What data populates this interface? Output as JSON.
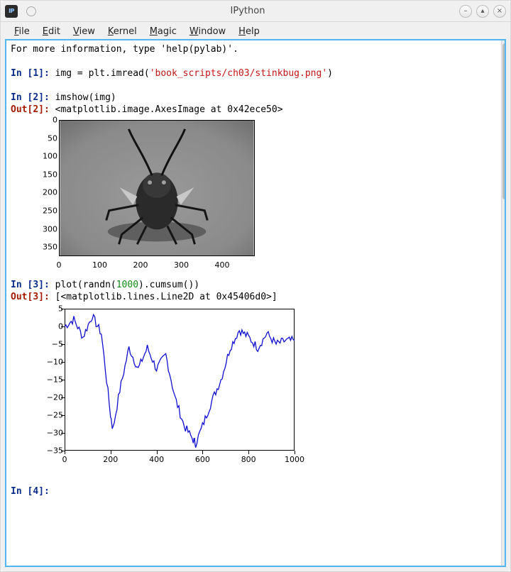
{
  "window": {
    "title": "IPython",
    "app_icon_text": "IP[y]"
  },
  "menubar": [
    {
      "key": "F",
      "rest": "ile"
    },
    {
      "key": "E",
      "rest": "dit"
    },
    {
      "key": "V",
      "rest": "iew"
    },
    {
      "key": "K",
      "rest": "ernel"
    },
    {
      "key": "M",
      "rest": "agic"
    },
    {
      "key": "W",
      "rest": "indow"
    },
    {
      "key": "H",
      "rest": "elp"
    }
  ],
  "preamble": "For more information, type 'help(pylab)'.",
  "cells": {
    "c1": {
      "in_label": "In [",
      "n": "1",
      "in_close": "]: ",
      "code_pre": "img = plt.imread(",
      "code_str": "'book_scripts/ch03/stinkbug.png'",
      "code_post": ")"
    },
    "c2": {
      "in_label": "In [",
      "n": "2",
      "in_close": "]: ",
      "code": "imshow(img)",
      "out_label": "Out[",
      "out_close": "]: ",
      "out_val": "<matplotlib.image.AxesImage at 0x42ece50>"
    },
    "c3": {
      "in_label": "In [",
      "n": "3",
      "in_close": "]: ",
      "code_pre": "plot(randn(",
      "code_num": "1000",
      "code_post": ").cumsum())",
      "out_label": "Out[",
      "out_close": "]: ",
      "out_val": "[<matplotlib.lines.Line2D at 0x45406d0>]"
    },
    "c4": {
      "in_label": "In [",
      "n": "4",
      "in_close": "]: "
    }
  },
  "chart_data": [
    {
      "type": "heatmap",
      "title": "",
      "description": "grayscale image displayed with imshow (stinkbug.png)",
      "xlabel": "",
      "ylabel": "",
      "xlim": [
        0,
        480
      ],
      "ylim": [
        375,
        0
      ],
      "x_ticks": [
        0,
        100,
        200,
        300,
        400
      ],
      "y_ticks": [
        0,
        50,
        100,
        150,
        200,
        250,
        300,
        350
      ]
    },
    {
      "type": "line",
      "title": "",
      "xlabel": "",
      "ylabel": "",
      "xlim": [
        0,
        1000
      ],
      "ylim": [
        -35,
        5
      ],
      "x_ticks": [
        0,
        200,
        400,
        600,
        800,
        1000
      ],
      "y_ticks": [
        -35,
        -30,
        -25,
        -20,
        -15,
        -10,
        -5,
        0,
        5
      ],
      "series": [
        {
          "name": "randn(1000).cumsum()",
          "color": "#1010d0",
          "x": [
            0,
            40,
            80,
            120,
            160,
            200,
            210,
            240,
            280,
            320,
            360,
            400,
            440,
            480,
            520,
            560,
            570,
            600,
            640,
            680,
            720,
            760,
            800,
            840,
            880,
            920,
            960,
            1000
          ],
          "values": [
            0,
            2,
            -3,
            3,
            -2,
            -25,
            -29,
            -18,
            -6,
            -12,
            -6,
            -12,
            -8,
            -20,
            -28,
            -32,
            -33,
            -28,
            -21,
            -15,
            -6,
            -1,
            -3,
            -6,
            -2,
            -5,
            -4,
            -4
          ]
        }
      ]
    }
  ]
}
